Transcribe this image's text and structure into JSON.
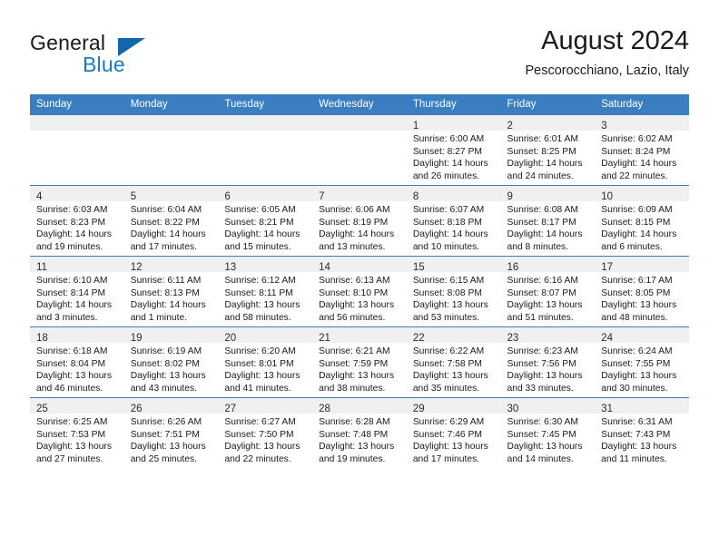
{
  "brand": {
    "name_top": "General",
    "name_bottom": "Blue",
    "accent_color": "#1a7ac4",
    "triangle_color": "#1266ab",
    "logo_icon": "triangle-flag-icon"
  },
  "header": {
    "month_title": "August 2024",
    "location": "Pescorocchiano, Lazio, Italy"
  },
  "calendar": {
    "header_bg": "#3a7dc0",
    "header_text_color": "#ffffff",
    "date_strip_bg": "#f0f0f0",
    "weekdays": [
      "Sunday",
      "Monday",
      "Tuesday",
      "Wednesday",
      "Thursday",
      "Friday",
      "Saturday"
    ],
    "weeks": [
      [
        {
          "day": "",
          "empty": true,
          "lines": []
        },
        {
          "day": "",
          "empty": true,
          "lines": []
        },
        {
          "day": "",
          "empty": true,
          "lines": []
        },
        {
          "day": "",
          "empty": true,
          "lines": []
        },
        {
          "day": "1",
          "empty": false,
          "lines": [
            "Sunrise: 6:00 AM",
            "Sunset: 8:27 PM",
            "Daylight: 14 hours",
            "and 26 minutes."
          ]
        },
        {
          "day": "2",
          "empty": false,
          "lines": [
            "Sunrise: 6:01 AM",
            "Sunset: 8:25 PM",
            "Daylight: 14 hours",
            "and 24 minutes."
          ]
        },
        {
          "day": "3",
          "empty": false,
          "lines": [
            "Sunrise: 6:02 AM",
            "Sunset: 8:24 PM",
            "Daylight: 14 hours",
            "and 22 minutes."
          ]
        }
      ],
      [
        {
          "day": "4",
          "empty": false,
          "lines": [
            "Sunrise: 6:03 AM",
            "Sunset: 8:23 PM",
            "Daylight: 14 hours",
            "and 19 minutes."
          ]
        },
        {
          "day": "5",
          "empty": false,
          "lines": [
            "Sunrise: 6:04 AM",
            "Sunset: 8:22 PM",
            "Daylight: 14 hours",
            "and 17 minutes."
          ]
        },
        {
          "day": "6",
          "empty": false,
          "lines": [
            "Sunrise: 6:05 AM",
            "Sunset: 8:21 PM",
            "Daylight: 14 hours",
            "and 15 minutes."
          ]
        },
        {
          "day": "7",
          "empty": false,
          "lines": [
            "Sunrise: 6:06 AM",
            "Sunset: 8:19 PM",
            "Daylight: 14 hours",
            "and 13 minutes."
          ]
        },
        {
          "day": "8",
          "empty": false,
          "lines": [
            "Sunrise: 6:07 AM",
            "Sunset: 8:18 PM",
            "Daylight: 14 hours",
            "and 10 minutes."
          ]
        },
        {
          "day": "9",
          "empty": false,
          "lines": [
            "Sunrise: 6:08 AM",
            "Sunset: 8:17 PM",
            "Daylight: 14 hours",
            "and 8 minutes."
          ]
        },
        {
          "day": "10",
          "empty": false,
          "lines": [
            "Sunrise: 6:09 AM",
            "Sunset: 8:15 PM",
            "Daylight: 14 hours",
            "and 6 minutes."
          ]
        }
      ],
      [
        {
          "day": "11",
          "empty": false,
          "lines": [
            "Sunrise: 6:10 AM",
            "Sunset: 8:14 PM",
            "Daylight: 14 hours",
            "and 3 minutes."
          ]
        },
        {
          "day": "12",
          "empty": false,
          "lines": [
            "Sunrise: 6:11 AM",
            "Sunset: 8:13 PM",
            "Daylight: 14 hours",
            "and 1 minute."
          ]
        },
        {
          "day": "13",
          "empty": false,
          "lines": [
            "Sunrise: 6:12 AM",
            "Sunset: 8:11 PM",
            "Daylight: 13 hours",
            "and 58 minutes."
          ]
        },
        {
          "day": "14",
          "empty": false,
          "lines": [
            "Sunrise: 6:13 AM",
            "Sunset: 8:10 PM",
            "Daylight: 13 hours",
            "and 56 minutes."
          ]
        },
        {
          "day": "15",
          "empty": false,
          "lines": [
            "Sunrise: 6:15 AM",
            "Sunset: 8:08 PM",
            "Daylight: 13 hours",
            "and 53 minutes."
          ]
        },
        {
          "day": "16",
          "empty": false,
          "lines": [
            "Sunrise: 6:16 AM",
            "Sunset: 8:07 PM",
            "Daylight: 13 hours",
            "and 51 minutes."
          ]
        },
        {
          "day": "17",
          "empty": false,
          "lines": [
            "Sunrise: 6:17 AM",
            "Sunset: 8:05 PM",
            "Daylight: 13 hours",
            "and 48 minutes."
          ]
        }
      ],
      [
        {
          "day": "18",
          "empty": false,
          "lines": [
            "Sunrise: 6:18 AM",
            "Sunset: 8:04 PM",
            "Daylight: 13 hours",
            "and 46 minutes."
          ]
        },
        {
          "day": "19",
          "empty": false,
          "lines": [
            "Sunrise: 6:19 AM",
            "Sunset: 8:02 PM",
            "Daylight: 13 hours",
            "and 43 minutes."
          ]
        },
        {
          "day": "20",
          "empty": false,
          "lines": [
            "Sunrise: 6:20 AM",
            "Sunset: 8:01 PM",
            "Daylight: 13 hours",
            "and 41 minutes."
          ]
        },
        {
          "day": "21",
          "empty": false,
          "lines": [
            "Sunrise: 6:21 AM",
            "Sunset: 7:59 PM",
            "Daylight: 13 hours",
            "and 38 minutes."
          ]
        },
        {
          "day": "22",
          "empty": false,
          "lines": [
            "Sunrise: 6:22 AM",
            "Sunset: 7:58 PM",
            "Daylight: 13 hours",
            "and 35 minutes."
          ]
        },
        {
          "day": "23",
          "empty": false,
          "lines": [
            "Sunrise: 6:23 AM",
            "Sunset: 7:56 PM",
            "Daylight: 13 hours",
            "and 33 minutes."
          ]
        },
        {
          "day": "24",
          "empty": false,
          "lines": [
            "Sunrise: 6:24 AM",
            "Sunset: 7:55 PM",
            "Daylight: 13 hours",
            "and 30 minutes."
          ]
        }
      ],
      [
        {
          "day": "25",
          "empty": false,
          "lines": [
            "Sunrise: 6:25 AM",
            "Sunset: 7:53 PM",
            "Daylight: 13 hours",
            "and 27 minutes."
          ]
        },
        {
          "day": "26",
          "empty": false,
          "lines": [
            "Sunrise: 6:26 AM",
            "Sunset: 7:51 PM",
            "Daylight: 13 hours",
            "and 25 minutes."
          ]
        },
        {
          "day": "27",
          "empty": false,
          "lines": [
            "Sunrise: 6:27 AM",
            "Sunset: 7:50 PM",
            "Daylight: 13 hours",
            "and 22 minutes."
          ]
        },
        {
          "day": "28",
          "empty": false,
          "lines": [
            "Sunrise: 6:28 AM",
            "Sunset: 7:48 PM",
            "Daylight: 13 hours",
            "and 19 minutes."
          ]
        },
        {
          "day": "29",
          "empty": false,
          "lines": [
            "Sunrise: 6:29 AM",
            "Sunset: 7:46 PM",
            "Daylight: 13 hours",
            "and 17 minutes."
          ]
        },
        {
          "day": "30",
          "empty": false,
          "lines": [
            "Sunrise: 6:30 AM",
            "Sunset: 7:45 PM",
            "Daylight: 13 hours",
            "and 14 minutes."
          ]
        },
        {
          "day": "31",
          "empty": false,
          "lines": [
            "Sunrise: 6:31 AM",
            "Sunset: 7:43 PM",
            "Daylight: 13 hours",
            "and 11 minutes."
          ]
        }
      ]
    ]
  }
}
